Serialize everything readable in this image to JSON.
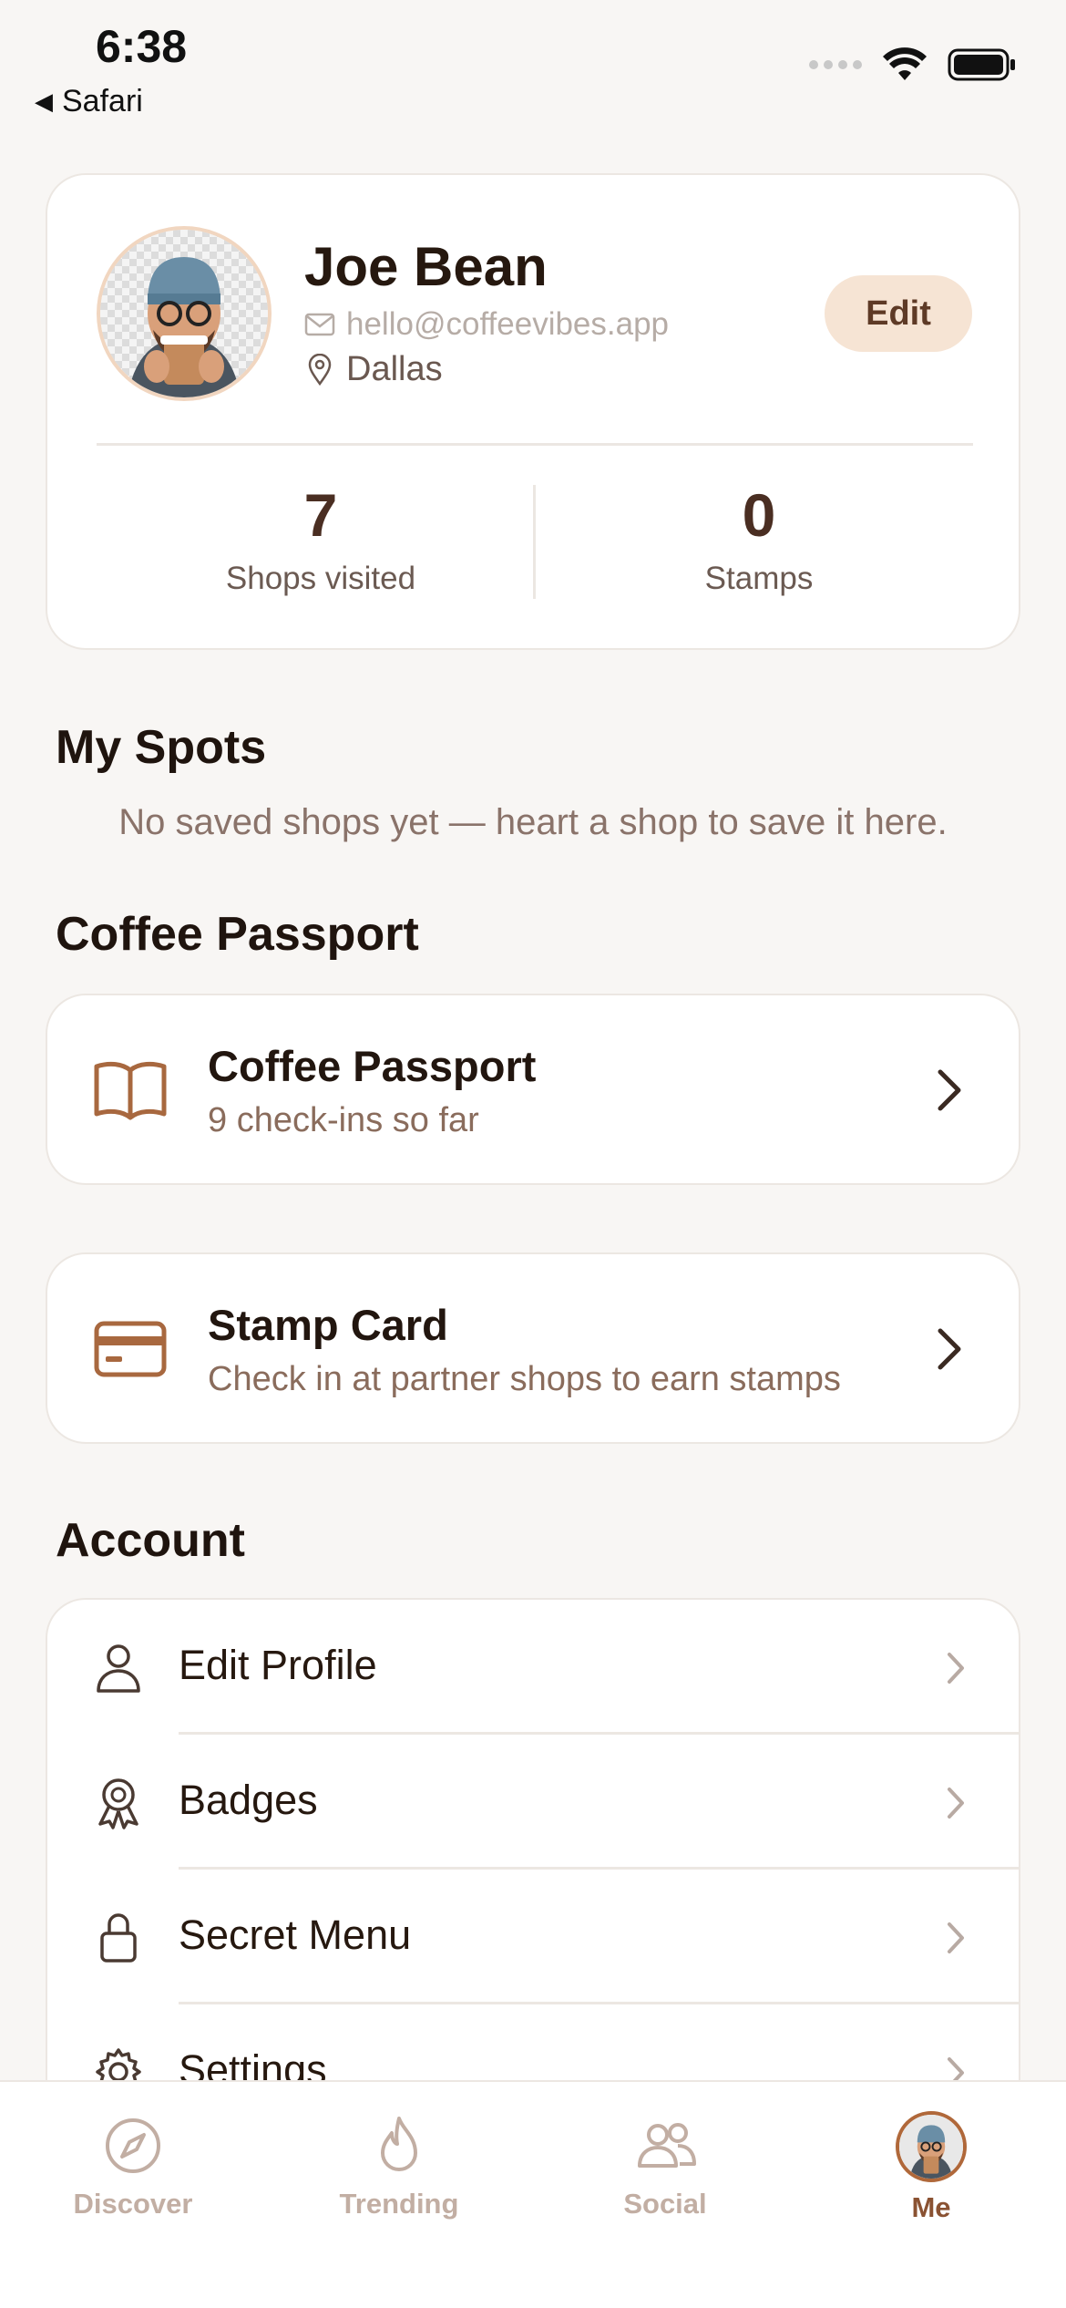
{
  "status_bar": {
    "time": "6:38",
    "back_app": "Safari"
  },
  "profile": {
    "name": "Joe Bean",
    "email": "hello@coffeevibes.app",
    "city": "Dallas",
    "edit_label": "Edit",
    "stats": [
      {
        "value": "7",
        "label": "Shops visited"
      },
      {
        "value": "0",
        "label": "Stamps"
      }
    ]
  },
  "my_spots": {
    "title": "My Spots",
    "empty_text": "No saved shops yet — heart a shop to save it here."
  },
  "passport_section": {
    "title": "Coffee Passport",
    "cards": [
      {
        "title": "Coffee Passport",
        "subtitle": "9 check-ins so far",
        "icon": "book-icon"
      },
      {
        "title": "Stamp Card",
        "subtitle": "Check in at partner shops to earn stamps",
        "icon": "card-icon"
      }
    ]
  },
  "account": {
    "title": "Account",
    "items": [
      {
        "label": "Edit Profile",
        "icon": "person-icon"
      },
      {
        "label": "Badges",
        "icon": "badge-icon"
      },
      {
        "label": "Secret Menu",
        "icon": "lock-icon"
      },
      {
        "label": "Settings",
        "icon": "gear-icon"
      }
    ]
  },
  "tab_bar": {
    "tabs": [
      {
        "label": "Discover",
        "icon": "compass-icon",
        "active": false
      },
      {
        "label": "Trending",
        "icon": "flame-icon",
        "active": false
      },
      {
        "label": "Social",
        "icon": "people-icon",
        "active": false
      },
      {
        "label": "Me",
        "icon": "avatar",
        "active": true
      }
    ]
  },
  "colors": {
    "background": "#f8f6f4",
    "accent_brown": "#8a5232",
    "edit_button_bg": "#f6e4d4",
    "inactive_tab": "#c2aea3"
  }
}
